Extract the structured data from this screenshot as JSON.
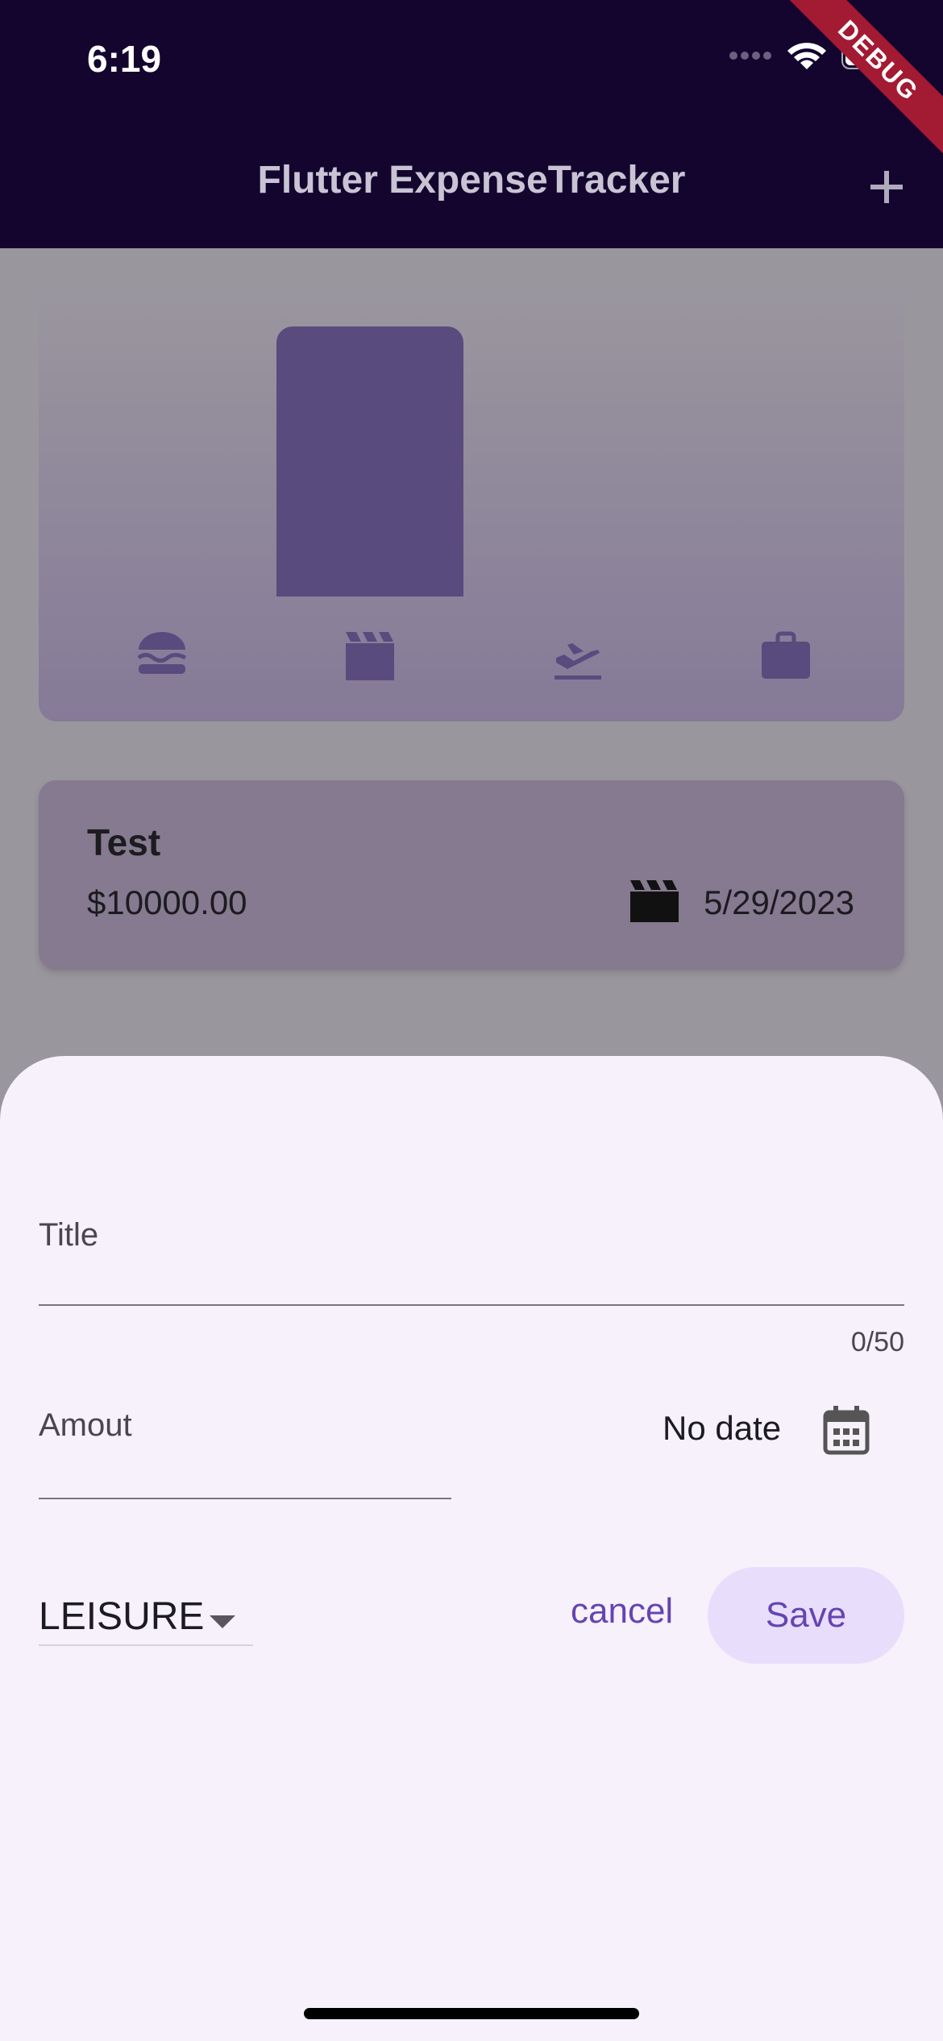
{
  "status_bar": {
    "time": "6:19",
    "debug_banner": "DEBUG"
  },
  "app_bar": {
    "title": "Flutter ExpenseTracker",
    "add_icon": "plus-icon"
  },
  "chart": {
    "bars": [
      {
        "category": "food",
        "icon": "burger-icon",
        "fill": 0.0
      },
      {
        "category": "leisure",
        "icon": "movie-clapper-icon",
        "fill": 1.0
      },
      {
        "category": "travel",
        "icon": "flight-takeoff-icon",
        "fill": 0.0
      },
      {
        "category": "work",
        "icon": "briefcase-icon",
        "fill": 0.0
      }
    ],
    "bar_color": "#5a4b7e"
  },
  "expenses": [
    {
      "title": "Test",
      "amount": "$10000.00",
      "category_icon": "movie-clapper-icon",
      "date": "5/29/2023"
    }
  ],
  "sheet": {
    "title_label": "Title",
    "title_counter": "0/50",
    "amount_label": "Amout",
    "date_value": "No date",
    "date_icon": "calendar-icon",
    "category_value": "LEISURE",
    "cancel_label": "cancel",
    "save_label": "Save"
  },
  "colors": {
    "app_bar": "#14052f",
    "accent": "#6544b2",
    "sheet_bg": "#f6f1fb",
    "save_bg": "#e8defc"
  }
}
